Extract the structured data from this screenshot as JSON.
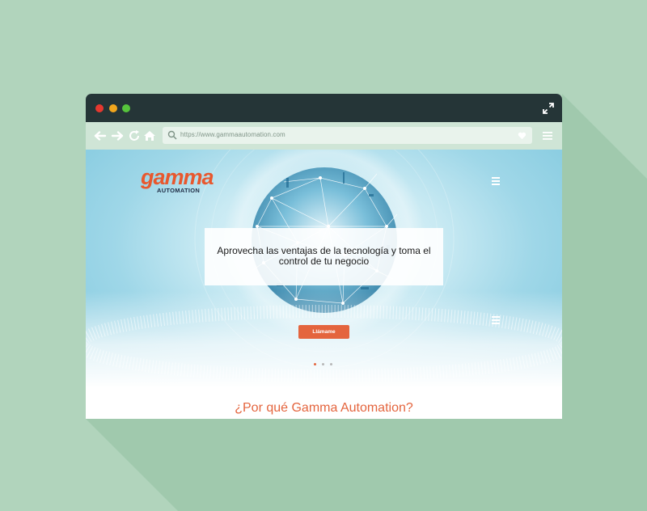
{
  "browser": {
    "url": "https://www.gammaautomation.com",
    "controls": [
      "close",
      "minimize",
      "maximize"
    ]
  },
  "site": {
    "logo": {
      "brand": "gamma",
      "sub": "AUTOMATION"
    },
    "hero": {
      "headline": "Aprovecha las ventajas de la tecnología y toma el control de tu negocio",
      "cta_label": "Llámame",
      "slides": 3,
      "active_slide": 1
    },
    "section_title": "¿Por qué Gamma Automation?"
  },
  "colors": {
    "background": "#b1d4bc",
    "titlebar": "#253537",
    "navbar": "#cfe5d6",
    "accent": "#e4653e",
    "logo_navy": "#1f2d45"
  },
  "icons": [
    "back-arrow-icon",
    "forward-arrow-icon",
    "reload-icon",
    "home-icon",
    "search-icon",
    "heart-icon",
    "hamburger-menu-icon",
    "expand-icon"
  ]
}
